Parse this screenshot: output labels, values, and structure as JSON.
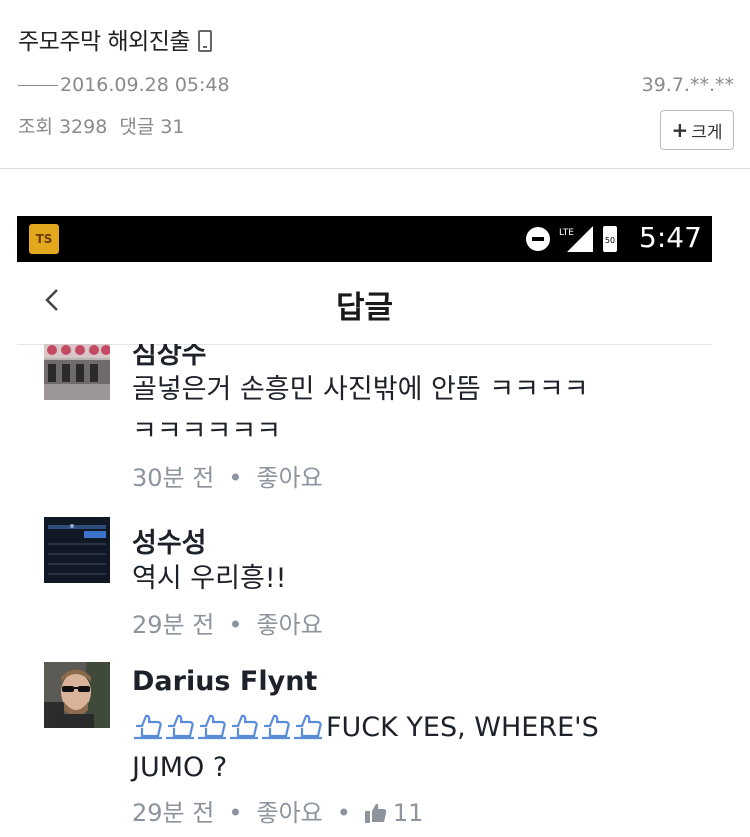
{
  "post": {
    "title": "주모주막 해외진출",
    "author_date": "2016.09.28 05:48",
    "ip": "39.7.**.**",
    "views_label": "조회",
    "views": "3298",
    "comments_label": "댓글",
    "comments": "31",
    "enlarge_label": "크게"
  },
  "screenshot": {
    "status": {
      "app_icon_text": "TS",
      "battery_text": "50",
      "time": "5:47"
    },
    "nav": {
      "title": "답글"
    },
    "comments": [
      {
        "author": "심상수",
        "text_lines": [
          "골넣은거 손흥민 사진밖에 안뜸 ㅋㅋㅋㅋ",
          "ㅋㅋㅋㅋㅋㅋ"
        ],
        "time": "30분 전",
        "separator": "•",
        "like_label": "좋아요"
      },
      {
        "author": "성수성",
        "text_lines": [
          "역시 우리흥!!"
        ],
        "time": "29분 전",
        "separator": "•",
        "like_label": "좋아요"
      },
      {
        "author": "Darius Flynt",
        "text_lines": [
          "FUCK YES, WHERE'S",
          "JUMO ?"
        ],
        "emoji_icon": "thumbs-up-emoji",
        "time": "29분 전",
        "separator": "•",
        "like_label": "좋아요",
        "like_count": "11"
      }
    ]
  },
  "colors": {
    "meta_gray": "#8d949e",
    "text_dark": "#1d2129",
    "emoji_blue": "#5b8dd6"
  }
}
